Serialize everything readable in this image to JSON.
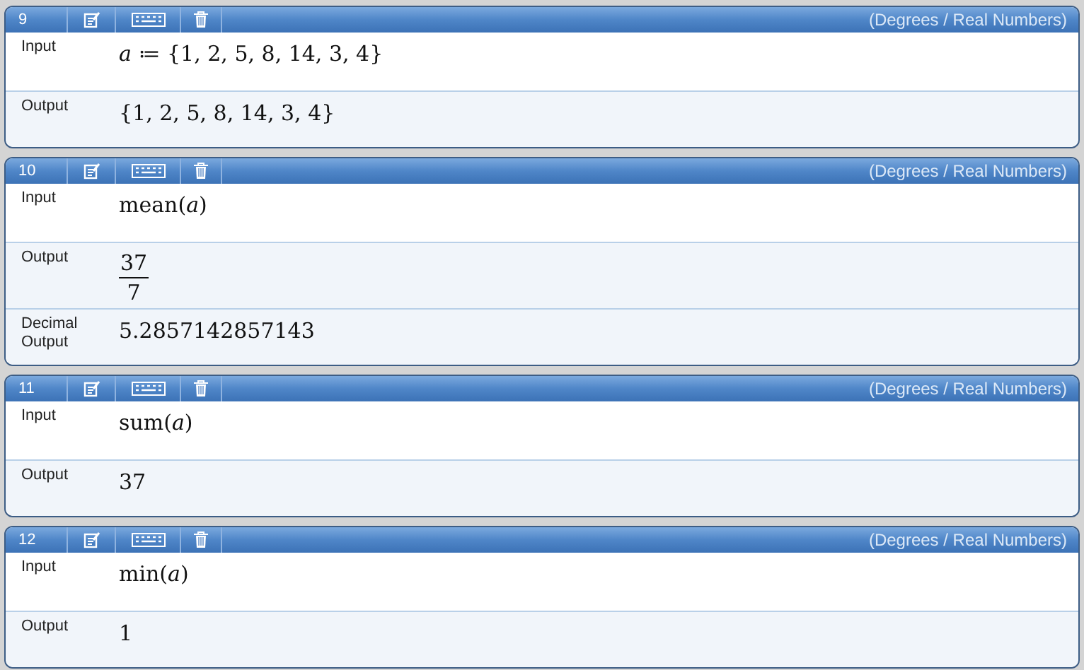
{
  "cells": [
    {
      "number": "9",
      "mode": "(Degrees / Real Numbers)",
      "rows": [
        {
          "kind": "input",
          "label": "Input",
          "expr": "*a* ≔ {1, 2, 5, 8, 14, 3, 4}"
        },
        {
          "kind": "output",
          "label": "Output",
          "expr": "{1, 2, 5, 8, 14, 3, 4}"
        }
      ]
    },
    {
      "number": "10",
      "mode": "(Degrees / Real Numbers)",
      "rows": [
        {
          "kind": "input",
          "label": "Input",
          "expr": "mean(*a*)"
        },
        {
          "kind": "fraction",
          "label": "Output",
          "numerator": "37",
          "denominator": "7"
        },
        {
          "kind": "output",
          "label": "Decimal Output",
          "expr": "5.2857142857143"
        }
      ]
    },
    {
      "number": "11",
      "mode": "(Degrees / Real Numbers)",
      "rows": [
        {
          "kind": "input",
          "label": "Input",
          "expr": "sum(*a*)"
        },
        {
          "kind": "output",
          "label": "Output",
          "expr": "37"
        }
      ]
    },
    {
      "number": "12",
      "mode": "(Degrees / Real Numbers)",
      "rows": [
        {
          "kind": "input",
          "label": "Input",
          "expr": "min(*a*)"
        },
        {
          "kind": "output",
          "label": "Output",
          "expr": "1"
        }
      ]
    }
  ]
}
